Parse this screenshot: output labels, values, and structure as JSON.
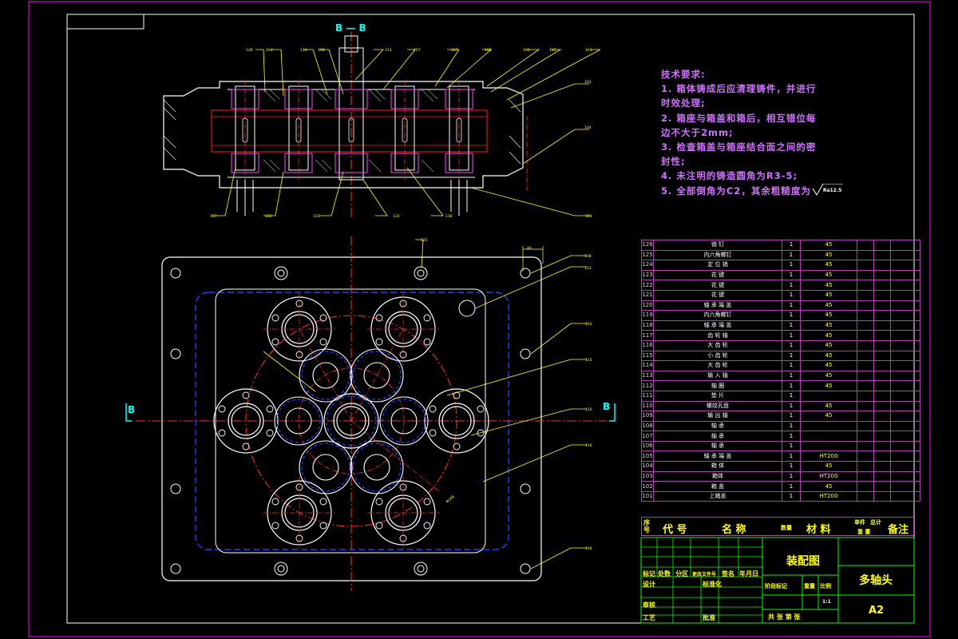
{
  "section": {
    "top_label": "B — B",
    "left_marker": "B",
    "right_marker": "B"
  },
  "technical_requirements": [
    "技术要求:",
    "1. 箱体铸成后应清理铸件，并进行",
    "时效处理;",
    "2. 箱座与箱盖和箱后，相互错位每",
    "边不大于2mm;",
    "3. 检查箱盖与箱座结合面之间的密",
    "封性;",
    "4. 未注明的铸造圆角为R3-5;",
    "5. 全部倒角为C2，其余粗糙度为"
  ],
  "roughness": "Ra12.5",
  "bom": [
    {
      "no": "126",
      "name": "销 钉",
      "qty": "1",
      "mat": "45"
    },
    {
      "no": "125",
      "name": "内六角螺钉",
      "qty": "1",
      "mat": "45"
    },
    {
      "no": "124",
      "name": "定 位 销",
      "qty": "1",
      "mat": "45"
    },
    {
      "no": "123",
      "name": "花 键",
      "qty": "1",
      "mat": "45"
    },
    {
      "no": "122",
      "name": "花 键",
      "qty": "1",
      "mat": "45"
    },
    {
      "no": "121",
      "name": "花 键",
      "qty": "1",
      "mat": "45"
    },
    {
      "no": "120",
      "name": "轴 承 端 盖",
      "qty": "1",
      "mat": "45"
    },
    {
      "no": "119",
      "name": "内六角螺钉",
      "qty": "1",
      "mat": "45"
    },
    {
      "no": "118",
      "name": "轴 承 端 盖",
      "qty": "1",
      "mat": "45"
    },
    {
      "no": "117",
      "name": "齿 轮 轴",
      "qty": "1",
      "mat": "45"
    },
    {
      "no": "116",
      "name": "大 齿 轮",
      "qty": "1",
      "mat": "45"
    },
    {
      "no": "115",
      "name": "小 齿 轮",
      "qty": "1",
      "mat": "45"
    },
    {
      "no": "114",
      "name": "大 齿 轮",
      "qty": "1",
      "mat": "45"
    },
    {
      "no": "113",
      "name": "输 入 轴",
      "qty": "1",
      "mat": "45"
    },
    {
      "no": "112",
      "name": "轴 圈",
      "qty": "1",
      "mat": "45"
    },
    {
      "no": "111",
      "name": "垫 片",
      "qty": "1",
      "mat": ""
    },
    {
      "no": "110",
      "name": "螺纹孔盘",
      "qty": "1",
      "mat": "45"
    },
    {
      "no": "109",
      "name": "输 出 轴",
      "qty": "1",
      "mat": "45"
    },
    {
      "no": "108",
      "name": "轴 承",
      "qty": "1",
      "mat": ""
    },
    {
      "no": "107",
      "name": "轴 承",
      "qty": "1",
      "mat": ""
    },
    {
      "no": "106",
      "name": "轴 承",
      "qty": "1",
      "mat": ""
    },
    {
      "no": "105",
      "name": "轴 承 端 盖",
      "qty": "1",
      "mat": "HT200"
    },
    {
      "no": "104",
      "name": "箱 体",
      "qty": "1",
      "mat": "45"
    },
    {
      "no": "103",
      "name": "箱体",
      "qty": "1",
      "mat": "HT200"
    },
    {
      "no": "102",
      "name": "箱 盖",
      "qty": "1",
      "mat": "45"
    },
    {
      "no": "101",
      "name": "上箱盖",
      "qty": "1",
      "mat": "HT200"
    }
  ],
  "bom_header": {
    "seq": "序号",
    "code": "代  号",
    "name": "名  称",
    "qty": "数量",
    "mat": "材  料",
    "unit_w": "单件",
    "total_w": "总计",
    "weight": "重  量",
    "remark": "备注"
  },
  "title_block": {
    "drawing_name": "装配图",
    "part_name": "多轴头",
    "sheet_size": "A2",
    "scale": "1:1",
    "mark_label": "标记",
    "count_label": "处数",
    "zone_label": "分区",
    "change_doc_label": "更改文件号",
    "sign_label": "签名",
    "date_label": "年月日",
    "design_label": "设计",
    "std_label": "标准化",
    "stage_label": "阶段标记",
    "weight_label": "重量",
    "scale_label": "比例",
    "check_label": "审核",
    "process_label": "工艺",
    "approve_label": "批准",
    "sheets_label": "共   张   第   张"
  }
}
